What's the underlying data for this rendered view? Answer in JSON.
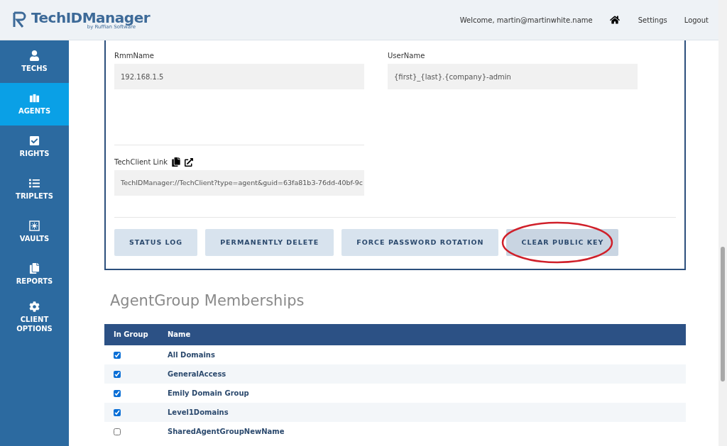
{
  "header": {
    "logo_text": "TechIDManager",
    "logo_tagline": "by Ruffian Software",
    "welcome": "Welcome, martin@martinwhite.name",
    "links": [
      "Settings",
      "Logout"
    ]
  },
  "sidebar": {
    "items": [
      {
        "label": "TECHS",
        "selected": false
      },
      {
        "label": "AGENTS",
        "selected": true
      },
      {
        "label": "RIGHTS",
        "selected": false
      },
      {
        "label": "TRIPLETS",
        "selected": false
      },
      {
        "label": "VAULTS",
        "selected": false
      },
      {
        "label": "REPORTS",
        "selected": false
      },
      {
        "label": "CLIENT OPTIONS",
        "selected": false
      }
    ]
  },
  "agent_form": {
    "fields": [
      {
        "label": "RmmName",
        "value": "192.168.1.5"
      },
      {
        "label": "UserName",
        "value": "{first}_{last}.{company}-admin"
      }
    ],
    "techclient_link": {
      "label": "TechClient Link",
      "value": "TechIDManager://TechClient?type=agent&guid=63fa81b3-76dd-40bf-9c"
    },
    "buttons": [
      {
        "label": "STATUS LOG",
        "highlighted": false
      },
      {
        "label": "PERMANENTLY DELETE",
        "highlighted": false
      },
      {
        "label": "FORCE PASSWORD ROTATION",
        "highlighted": false
      },
      {
        "label": "CLEAR PUBLIC KEY",
        "highlighted": true
      }
    ]
  },
  "memberships": {
    "title": "AgentGroup Memberships",
    "columns": [
      "In Group",
      "Name"
    ],
    "rows": [
      {
        "checked": true,
        "name": "All Domains"
      },
      {
        "checked": true,
        "name": "GeneralAccess"
      },
      {
        "checked": true,
        "name": "Emily Domain Group"
      },
      {
        "checked": true,
        "name": "Level1Domains"
      },
      {
        "checked": false,
        "name": "SharedAgentGroupNewName"
      }
    ]
  }
}
